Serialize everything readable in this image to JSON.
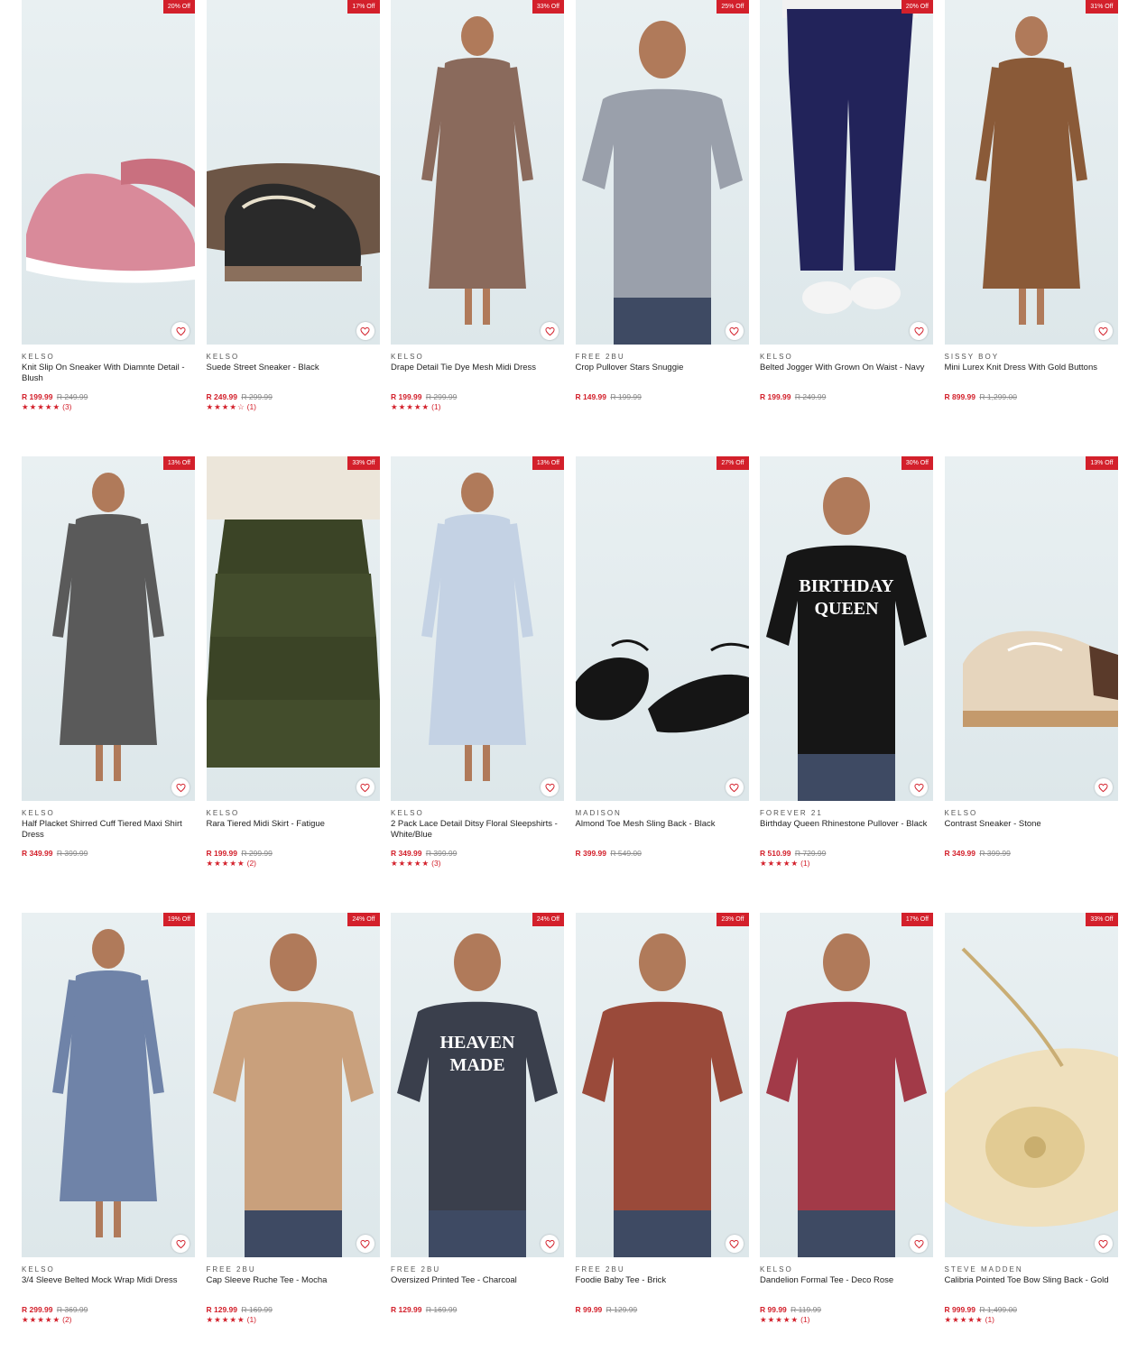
{
  "products": [
    {
      "badge": "20% Off",
      "brand": "KELSO",
      "name": "Knit Slip On Sneaker With Diamnte Detail - Blush",
      "price": "R 199.99",
      "was": "R 249.99",
      "stars": "★★★★★",
      "count": "(3)",
      "art": "shoe-pink",
      "accent": "#d98a9a"
    },
    {
      "badge": "17% Off",
      "brand": "KELSO",
      "name": "Suede Street Sneaker - Black",
      "price": "R 249.99",
      "was": "R 299.99",
      "stars": "★★★★☆",
      "count": "(1)",
      "art": "shoe-black",
      "accent": "#2a2a2a"
    },
    {
      "badge": "33% Off",
      "brand": "KELSO",
      "name": "Drape Detail Tie Dye Mesh Midi Dress",
      "price": "R 199.99",
      "was": "R 299.99",
      "stars": "★★★★★",
      "count": "(1)",
      "art": "dress",
      "accent": "#8a6a5c"
    },
    {
      "badge": "25% Off",
      "brand": "FREE 2BU",
      "name": "Crop Pullover Stars Snuggie",
      "price": "R 149.99",
      "was": "R 199.99",
      "stars": "",
      "count": "",
      "art": "top",
      "accent": "#9aa0ab"
    },
    {
      "badge": "20% Off",
      "brand": "KELSO",
      "name": "Belted Jogger With Grown On Waist - Navy",
      "price": "R 199.99",
      "was": "R 249.99",
      "stars": "",
      "count": "",
      "art": "pants",
      "accent": "#22235a"
    },
    {
      "badge": "31% Off",
      "brand": "SISSY BOY",
      "name": "Mini Lurex Knit Dress With Gold Buttons",
      "price": "R 899.99",
      "was": "R 1,299.00",
      "stars": "",
      "count": "",
      "art": "dress",
      "accent": "#8a5a38"
    },
    {
      "badge": "13% Off",
      "brand": "KELSO",
      "name": "Half Placket Shirred Cuff Tiered Maxi Shirt Dress",
      "price": "R 349.99",
      "was": "R 399.99",
      "stars": "",
      "count": "",
      "art": "dress",
      "accent": "#5a5a5a"
    },
    {
      "badge": "33% Off",
      "brand": "KELSO",
      "name": "Rara Tiered Midi Skirt - Fatigue",
      "price": "R 199.99",
      "was": "R 299.99",
      "stars": "★★★★★",
      "count": "(2)",
      "art": "skirt",
      "accent": "#3b4426"
    },
    {
      "badge": "13% Off",
      "brand": "KELSO",
      "name": "2 Pack Lace Detail Ditsy Floral Sleepshirts - White/Blue",
      "price": "R 349.99",
      "was": "R 399.99",
      "stars": "★★★★★",
      "count": "(3)",
      "art": "dress",
      "accent": "#c4d2e4"
    },
    {
      "badge": "27% Off",
      "brand": "MADISON",
      "name": "Almond Toe Mesh Sling Back - Black",
      "price": "R 399.99",
      "was": "R 549.00",
      "stars": "",
      "count": "",
      "art": "flats",
      "accent": "#151515"
    },
    {
      "badge": "30% Off",
      "brand": "FOREVER 21",
      "name": "Birthday Queen Rhinestone Pullover - Black",
      "price": "R 510.99",
      "was": "R 729.99",
      "stars": "★★★★★",
      "count": "(1)",
      "art": "top",
      "accent": "#161616",
      "print": "BIRTHDAY QUEEN"
    },
    {
      "badge": "13% Off",
      "brand": "KELSO",
      "name": "Contrast Sneaker - Stone",
      "price": "R 349.99",
      "was": "R 399.99",
      "stars": "",
      "count": "",
      "art": "shoe-stone",
      "accent": "#e6d5bd"
    },
    {
      "badge": "19% Off",
      "brand": "KELSO",
      "name": "3/4 Sleeve Belted Mock Wrap Midi Dress",
      "price": "R 299.99",
      "was": "R 369.99",
      "stars": "★★★★★",
      "count": "(2)",
      "art": "dress",
      "accent": "#6f83a8"
    },
    {
      "badge": "24% Off",
      "brand": "FREE 2BU",
      "name": "Cap Sleeve Ruche Tee - Mocha",
      "price": "R 129.99",
      "was": "R 169.99",
      "stars": "★★★★★",
      "count": "(1)",
      "art": "top",
      "accent": "#c9a07c"
    },
    {
      "badge": "24% Off",
      "brand": "FREE 2BU",
      "name": "Oversized Printed Tee - Charcoal",
      "price": "R 129.99",
      "was": "R 169.99",
      "stars": "",
      "count": "",
      "art": "top",
      "accent": "#3a3f4c",
      "print": "HEAVEN MADE"
    },
    {
      "badge": "23% Off",
      "brand": "FREE 2BU",
      "name": "Foodie Baby Tee - Brick",
      "price": "R 99.99",
      "was": "R 129.99",
      "stars": "",
      "count": "",
      "art": "top",
      "accent": "#9a4a3a"
    },
    {
      "badge": "17% Off",
      "brand": "KELSO",
      "name": "Dandelion Formal Tee - Deco Rose",
      "price": "R 99.99",
      "was": "R 119.99",
      "stars": "★★★★★",
      "count": "(1)",
      "art": "top",
      "accent": "#a23a48"
    },
    {
      "badge": "33% Off",
      "brand": "STEVE MADDEN",
      "name": "Calibria Pointed Toe Bow Sling Back - Gold",
      "price": "R 999.99",
      "was": "R 1,499.00",
      "stars": "★★★★★",
      "count": "(1)",
      "art": "shoe-gold",
      "accent": "#e9d7ad"
    }
  ]
}
